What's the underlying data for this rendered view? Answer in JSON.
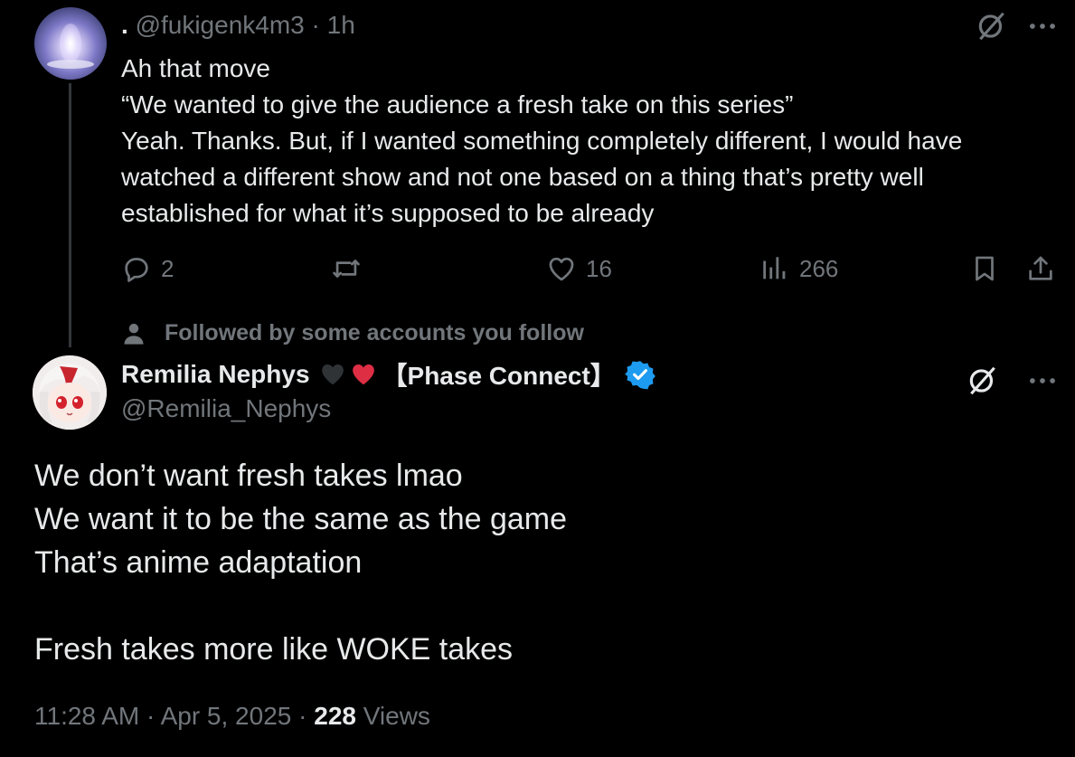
{
  "parent_tweet": {
    "display_name": ".",
    "handle": "@fukigenk4m3",
    "separator": "·",
    "time": "1h",
    "lines": [
      "Ah that move",
      "“We wanted to give the audience a fresh take on this series”",
      "Yeah. Thanks. But, if I wanted something completely different, I would have",
      "watched a different show and not one based on a thing that’s pretty well",
      "established for what it’s supposed to be already"
    ],
    "replies": "2",
    "reposts": "",
    "likes": "16",
    "views": "266"
  },
  "social_context": "Followed by some accounts you follow",
  "main_tweet": {
    "display_name": "Remilia Nephys",
    "affiliation": "【Phase Connect】",
    "handle": "@Remilia_Nephys",
    "lines": [
      "We don’t want fresh takes lmao",
      "We want it to be the same as the game",
      "That’s anime adaptation",
      "",
      "Fresh takes more like WOKE takes"
    ],
    "time": "11:28 AM",
    "sep1": "·",
    "date": "Apr 5, 2025",
    "sep2": "·",
    "views_count": "228",
    "views_label": "Views"
  },
  "colors": {
    "background": "#000000",
    "text": "#e7e9ea",
    "muted": "#71767b",
    "verified": "#1d9bf0",
    "heart_red": "#e0245e",
    "heart_black": "#292f33"
  },
  "icons": [
    "grok-icon",
    "more-icon",
    "reply-icon",
    "repost-icon",
    "like-icon",
    "views-icon",
    "bookmark-icon",
    "share-icon",
    "person-icon",
    "verified-icon",
    "black-heart-emoji",
    "red-heart-emoji"
  ]
}
